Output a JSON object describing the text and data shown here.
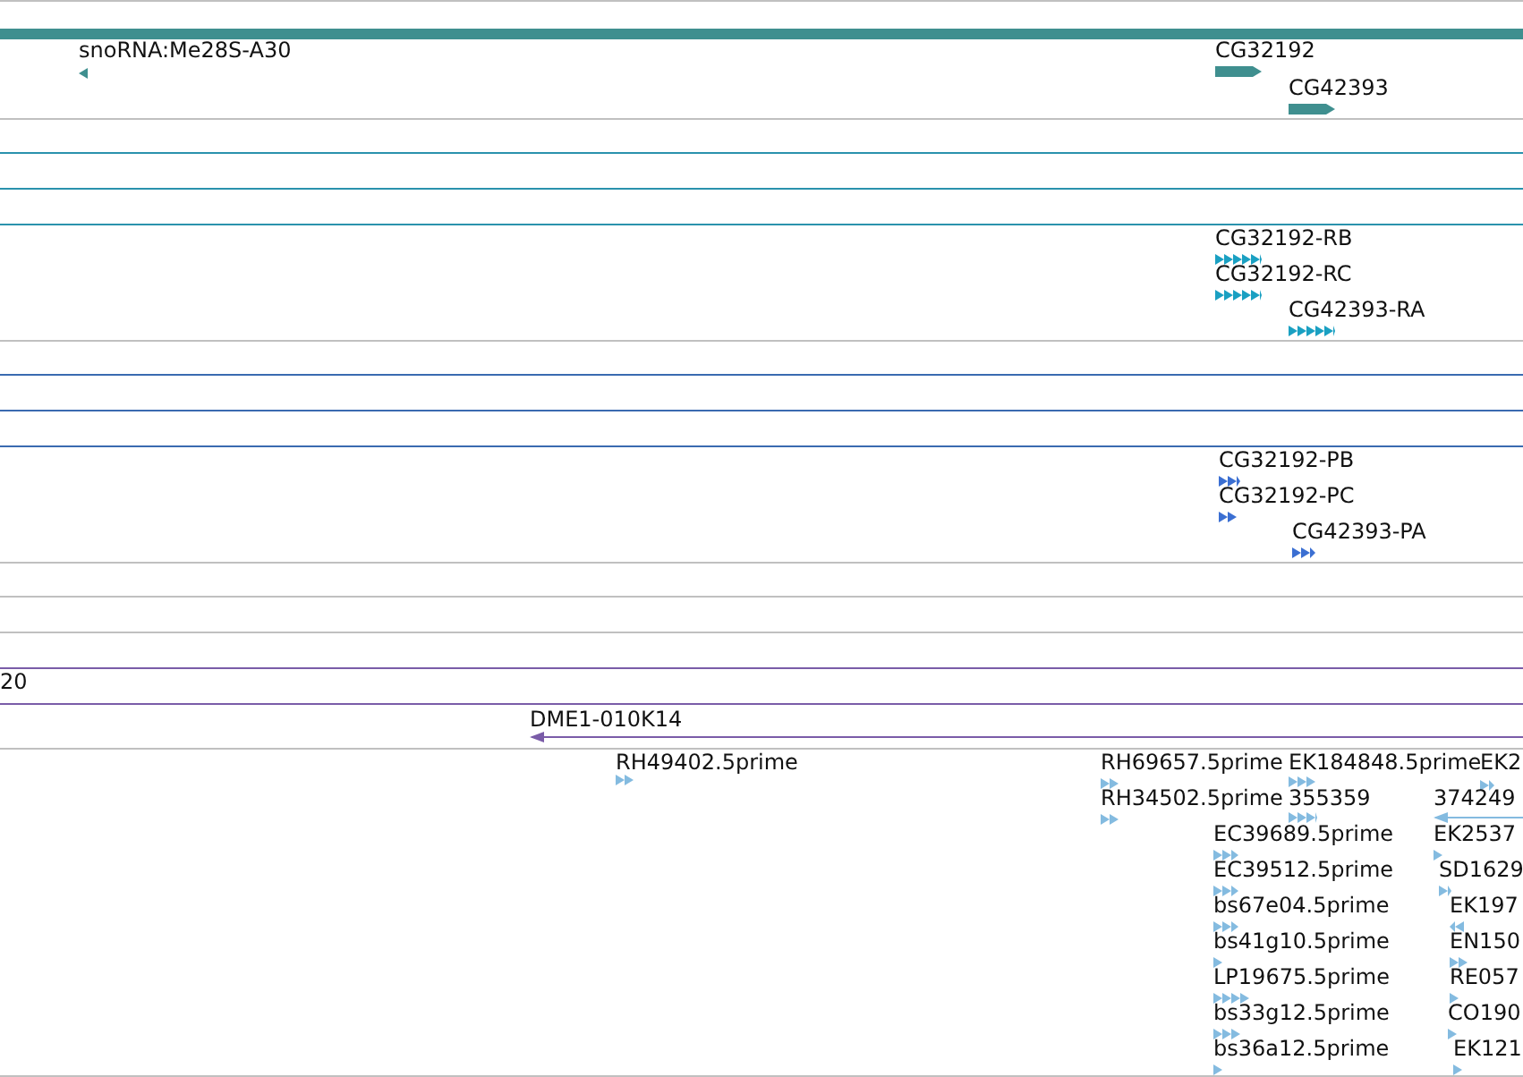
{
  "tracks": [
    {
      "kind": "gene",
      "features": [
        {
          "label": "snoRNA:Me28S-A30",
          "reverse": true
        },
        {
          "label": "CG32192",
          "reverse": false
        },
        {
          "label": "CG42393",
          "reverse": false
        }
      ]
    },
    {
      "kind": "transcript",
      "features": [
        {
          "label": "CG32192-RB",
          "reverse": false
        },
        {
          "label": "CG32192-RC",
          "reverse": false
        },
        {
          "label": "CG42393-RA",
          "reverse": false
        }
      ]
    },
    {
      "kind": "protein",
      "features": [
        {
          "label": "CG32192-PB",
          "reverse": false
        },
        {
          "label": "CG32192-PC",
          "reverse": false
        },
        {
          "label": "CG42393-PA",
          "reverse": false
        }
      ]
    },
    {
      "kind": "clone",
      "features": [
        {
          "label": "20"
        }
      ]
    },
    {
      "kind": "clone",
      "features": [
        {
          "label": "DME1-010K14",
          "reverse": true
        }
      ]
    },
    {
      "kind": "est",
      "features": [
        {
          "label": "RH49402.5prime",
          "reverse": false
        },
        {
          "label": "RH69657.5prime",
          "reverse": false
        },
        {
          "label": "EK184848.5prime",
          "reverse": false
        },
        {
          "label": "EK2",
          "reverse": false
        },
        {
          "label": "RH34502.5prime",
          "reverse": false
        },
        {
          "label": "355359",
          "reverse": false
        },
        {
          "label": "374249",
          "reverse": true
        },
        {
          "label": "EC39689.5prime",
          "reverse": false
        },
        {
          "label": "EK2537",
          "reverse": false
        },
        {
          "label": "EC39512.5prime",
          "reverse": false
        },
        {
          "label": "SD1629",
          "reverse": false
        },
        {
          "label": "bs67e04.5prime",
          "reverse": false
        },
        {
          "label": "EK197",
          "reverse": true
        },
        {
          "label": "bs41g10.5prime",
          "reverse": false
        },
        {
          "label": "EN150",
          "reverse": false
        },
        {
          "label": "LP19675.5prime",
          "reverse": false
        },
        {
          "label": "RE057",
          "reverse": false
        },
        {
          "label": "bs33g12.5prime",
          "reverse": false
        },
        {
          "label": "CO190",
          "reverse": false
        },
        {
          "label": "bs36a12.5prime",
          "reverse": false
        },
        {
          "label": "EK121",
          "reverse": false
        }
      ]
    }
  ]
}
